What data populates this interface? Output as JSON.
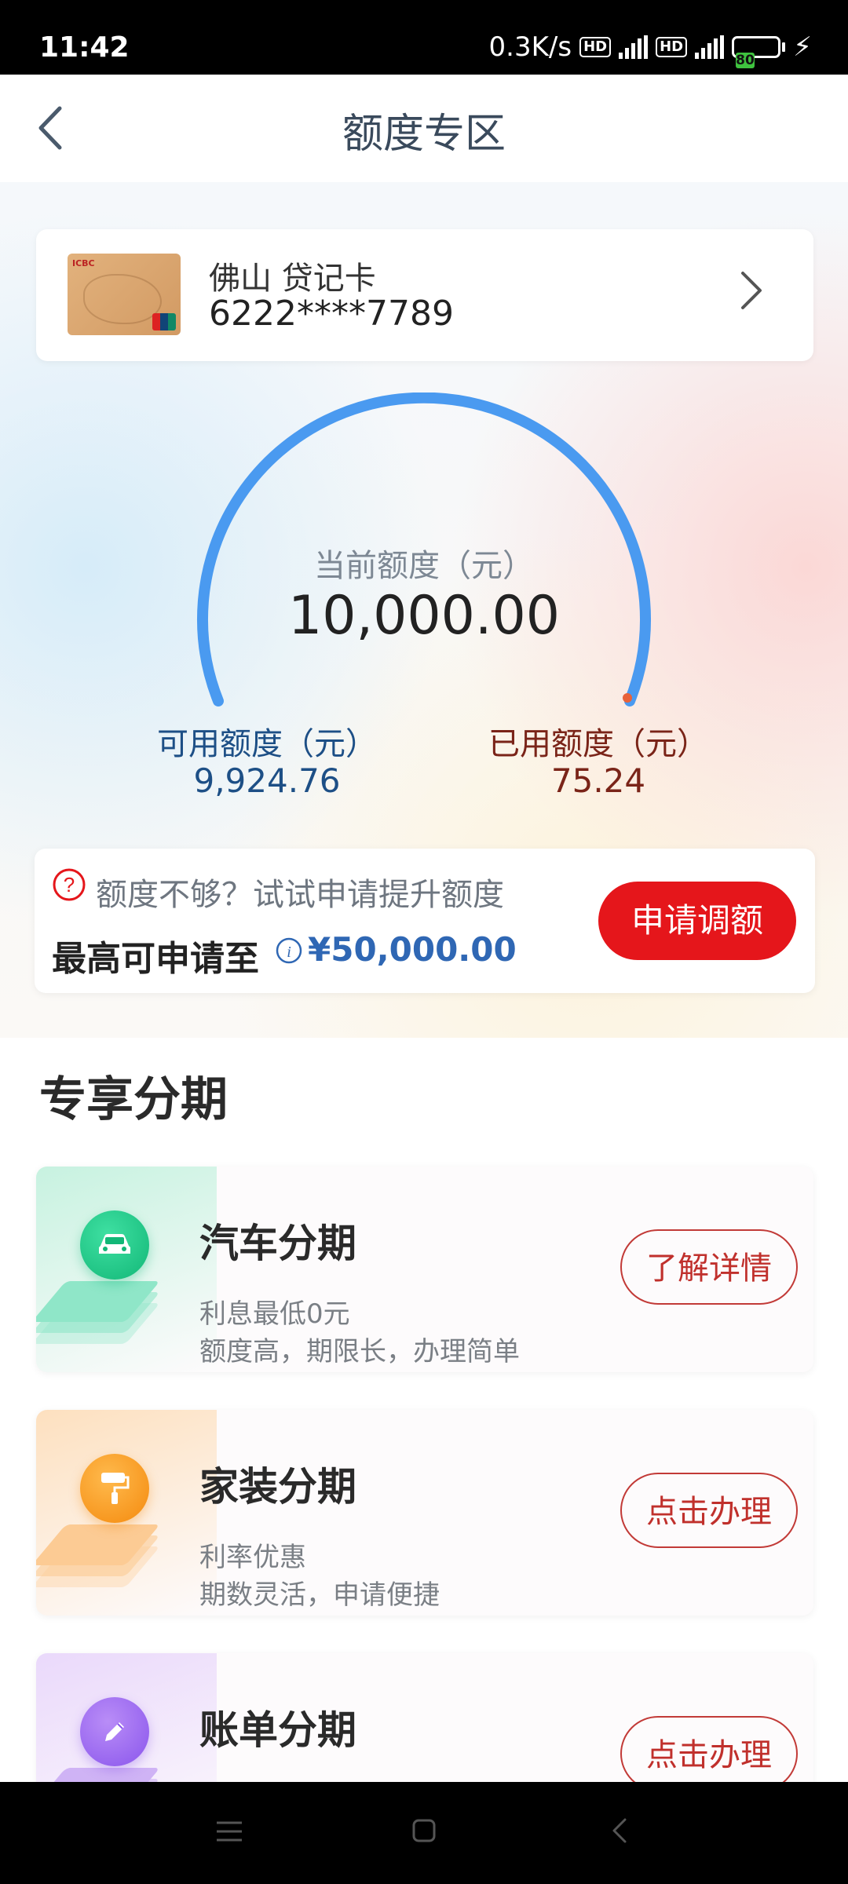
{
  "status_bar": {
    "time": "11:42",
    "speed": "0.3K/s",
    "hd": "HD",
    "network": "4G",
    "battery": "80"
  },
  "header": {
    "title": "额度专区"
  },
  "card": {
    "name": "佛山 贷记卡",
    "number": "6222****7789"
  },
  "quota": {
    "current_label": "当前额度（元）",
    "current_value": "10,000.00",
    "available_label": "可用额度（元）",
    "available_value": "9,924.76",
    "used_label": "已用额度（元）",
    "used_value": "75.24",
    "used_fraction": 0.0075
  },
  "raise": {
    "hint": "额度不够？试试申请提升额度",
    "max_label": "最高可申请至",
    "max_value": "¥50,000.00",
    "button_label": "申请调额"
  },
  "installments": {
    "section_title": "专享分期",
    "items": [
      {
        "title": "汽车分期",
        "line1": "利息最低0元",
        "line2": "额度高，期限长，办理简单",
        "button": "了解详情",
        "icon": "car-icon"
      },
      {
        "title": "家装分期",
        "line1": "利率优惠",
        "line2": "期数灵活，申请便捷",
        "button": "点击办理",
        "icon": "paint-roller-icon"
      },
      {
        "title": "账单分期",
        "line1": "",
        "line2": "",
        "button": "点击办理",
        "icon": "pen-icon"
      }
    ]
  },
  "colors": {
    "gauge_blue": "#4a9af0",
    "used_dot": "#e8623a",
    "primary_red": "#e5161b",
    "available_text": "#1d4f86",
    "used_text": "#7a2418"
  }
}
